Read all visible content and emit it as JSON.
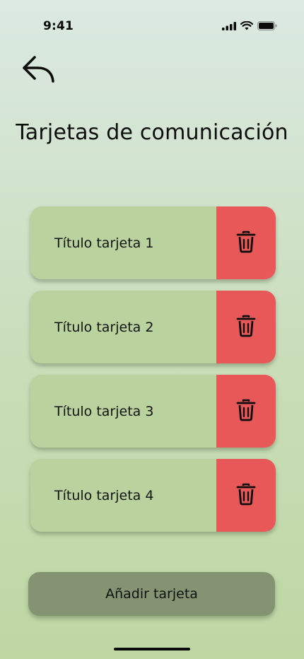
{
  "status_bar": {
    "time": "9:41",
    "icons": [
      "cellular-signal-icon",
      "wifi-icon",
      "battery-icon"
    ]
  },
  "header": {
    "back_icon": "reply-arrow-icon",
    "title": "Tarjetas de comunicación"
  },
  "cards": [
    {
      "title": "Título tarjeta 1",
      "delete_icon": "trash-icon"
    },
    {
      "title": "Título tarjeta 2",
      "delete_icon": "trash-icon"
    },
    {
      "title": "Título tarjeta 3",
      "delete_icon": "trash-icon"
    },
    {
      "title": "Título tarjeta 4",
      "delete_icon": "trash-icon"
    }
  ],
  "add_button": {
    "label": "Añadir tarjeta"
  },
  "colors": {
    "card_background": "#b9d29e",
    "delete_background": "#e85858",
    "add_button_background": "#849472"
  }
}
